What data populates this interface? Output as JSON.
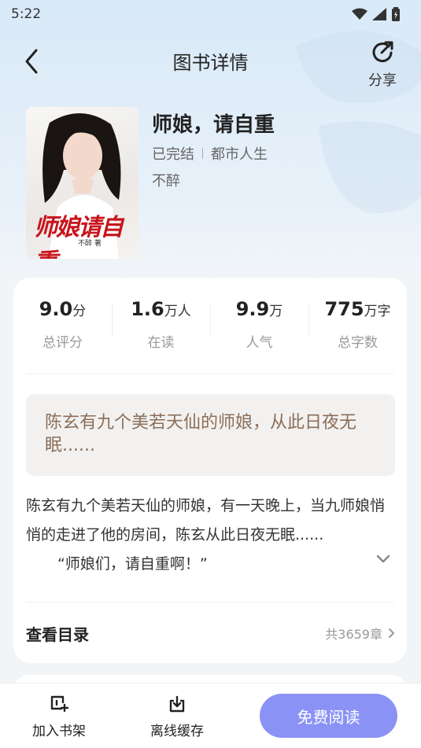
{
  "status_bar": {
    "time": "5:22"
  },
  "nav": {
    "title": "图书详情",
    "share_label": "分享"
  },
  "book": {
    "title": "师娘，请自重",
    "status": "已完结",
    "category": "都市人生",
    "author": "不醉",
    "cover_title": "师娘请自重",
    "cover_author": "不醉 著"
  },
  "stats": [
    {
      "value": "9.0",
      "unit": "分",
      "label": "总评分"
    },
    {
      "value": "1.6",
      "unit": "万人",
      "label": "在读"
    },
    {
      "value": "9.9",
      "unit": "万",
      "label": "人气"
    },
    {
      "value": "775",
      "unit": "万字",
      "label": "总字数"
    }
  ],
  "tagline": "陈玄有九个美若天仙的师娘，从此日夜无眠......",
  "intro": {
    "text": "陈玄有九个美若天仙的师娘，有一天晚上，当九师娘悄悄的走进了他的房间，陈玄从此日夜无眠......",
    "quote": "“师娘们，请自重啊！”"
  },
  "toc": {
    "label": "查看目录",
    "count": "共3659章"
  },
  "bottom_bar": {
    "shelf_label": "加入书架",
    "cache_label": "离线缓存",
    "read_label": "免费阅读"
  },
  "colors": {
    "accent": "#8a92f5",
    "tagline": "#8b6e58",
    "cover_title": "#c8141c"
  }
}
